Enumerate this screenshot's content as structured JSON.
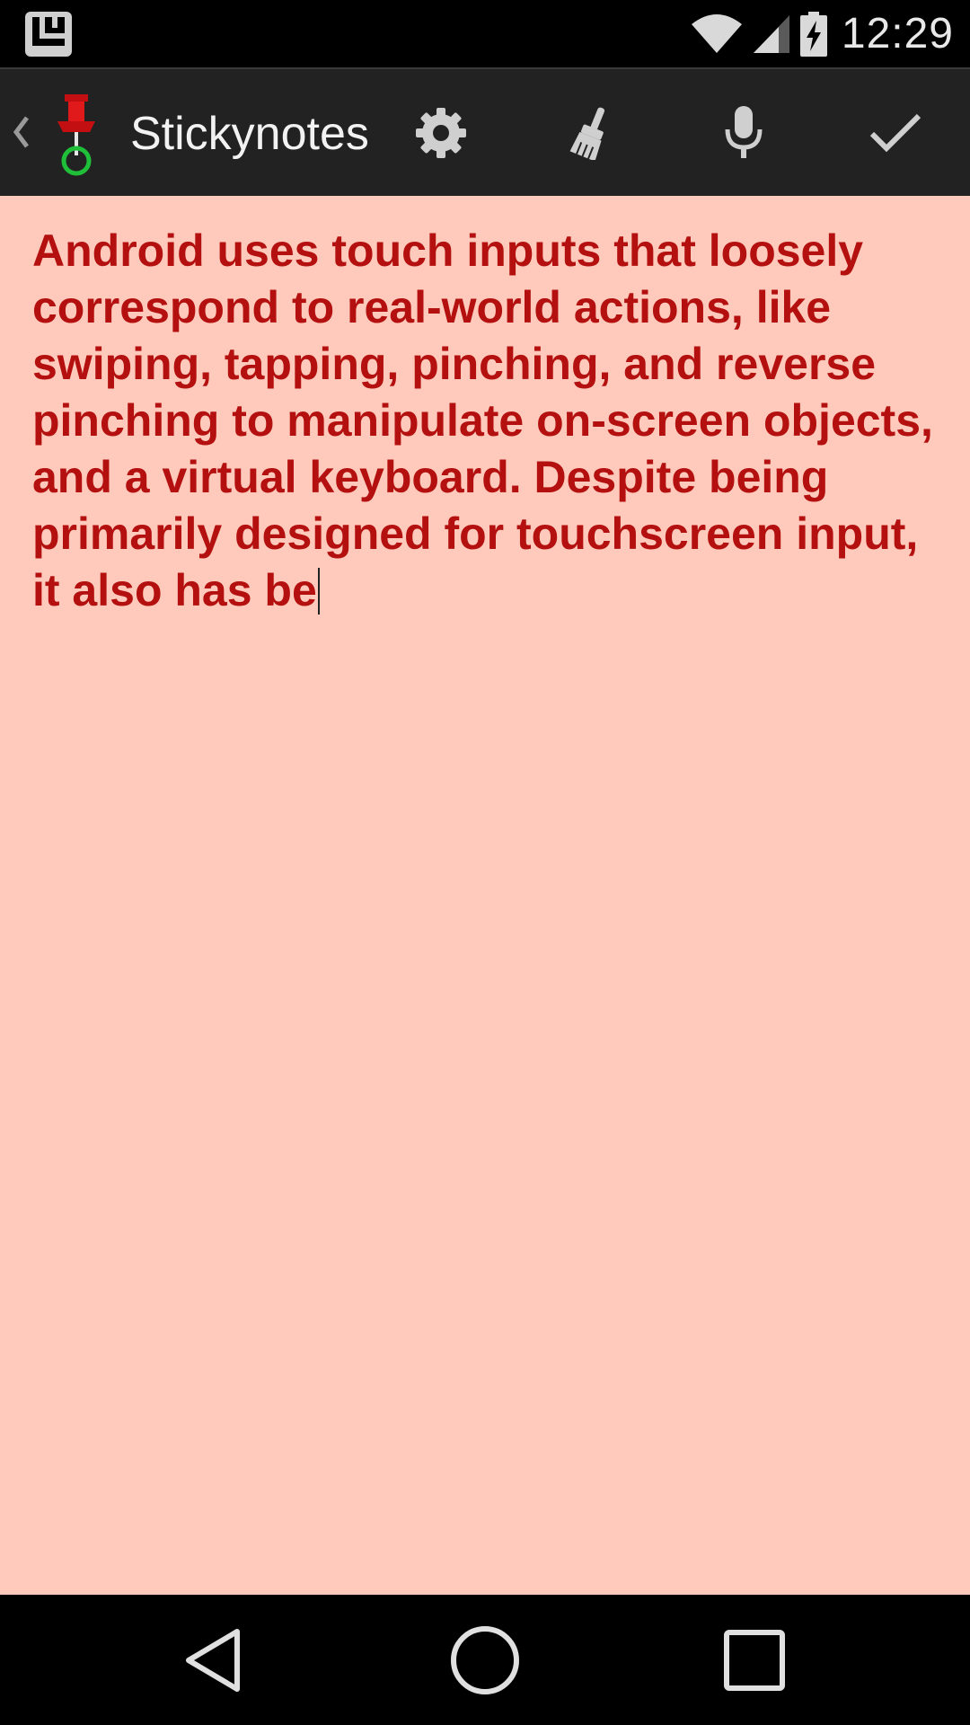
{
  "status_bar": {
    "time": "12:29",
    "icons": [
      "launcher-notification-icon",
      "wifi-icon",
      "cell-signal-icon",
      "battery-charging-icon"
    ]
  },
  "action_bar": {
    "title": "Stickynotes",
    "icons": {
      "up": "chevron-left-icon",
      "app": "pushpin-icon",
      "settings": "gear-icon",
      "clear": "brush-icon",
      "voice": "microphone-icon",
      "done": "checkmark-icon"
    }
  },
  "note": {
    "text": "Android uses touch inputs that loosely correspond to real-world actions, like swiping, tapping, pinching, and reverse pinching to manipulate on-screen objects, and a virtual keyboard. Despite being primarily designed for touchscreen input, it also has be",
    "background_color": "#ffcabb",
    "text_color": "#b3100f"
  },
  "nav_bar": {
    "icons": [
      "back-icon",
      "home-icon",
      "recents-icon"
    ]
  }
}
